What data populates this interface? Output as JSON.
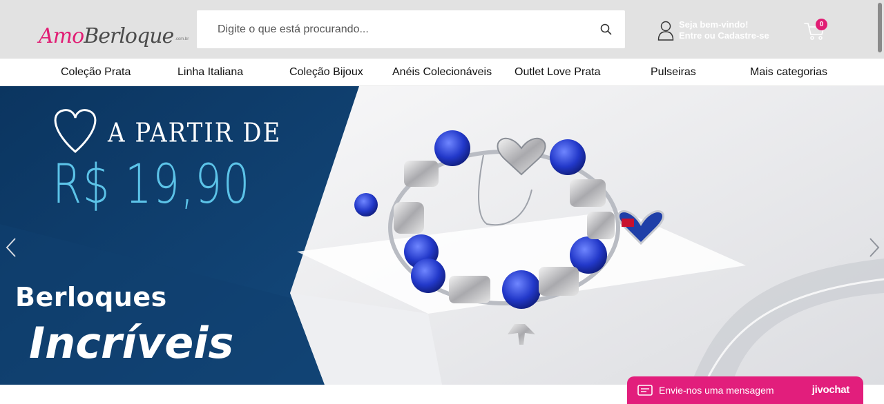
{
  "header": {
    "logo": {
      "text_a": "Amo",
      "text_b": "Berloque",
      "suffix": ".com.br"
    },
    "search": {
      "placeholder": "Digite o que está procurando...",
      "icon": "search-icon"
    },
    "user": {
      "greeting": "Seja bem-vindo!",
      "action": "Entre ou Cadastre-se",
      "icon": "user-icon"
    },
    "cart": {
      "count": "0",
      "icon": "cart-icon"
    }
  },
  "nav": {
    "items": [
      {
        "label": "Coleção Prata"
      },
      {
        "label": "Linha Italiana"
      },
      {
        "label": "Coleção Bijoux"
      },
      {
        "label": "Anéis Colecionáveis"
      },
      {
        "label": "Outlet Love Prata"
      },
      {
        "label": "Pulseiras"
      },
      {
        "label": "Mais categorias"
      }
    ]
  },
  "banner": {
    "promo_label": "A PARTIR DE",
    "promo_price": "R$ 19,90",
    "headline_1": "Berloques",
    "headline_2": "Incríveis",
    "prev_icon": "chevron-left-icon",
    "next_icon": "chevron-right-icon"
  },
  "chat": {
    "label": "Envie-nos uma mensagem",
    "brand": "jivochat",
    "icon": "message-icon"
  },
  "colors": {
    "brand_pink": "#e11d74",
    "header_bg": "#e2e2e2",
    "banner_navy": "#0f3a66",
    "price_blue": "#5cc3e8",
    "chat_pink": "#e21e7c"
  }
}
